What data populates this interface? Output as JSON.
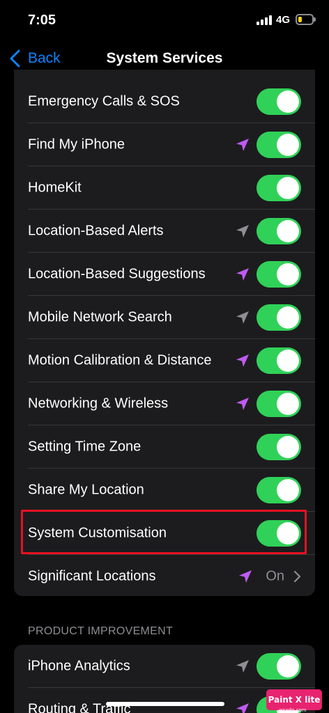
{
  "status_bar": {
    "time": "7:05",
    "network": "4G",
    "battery_level": 0.3,
    "battery_color": "#ffd60a"
  },
  "nav": {
    "back_label": "Back",
    "title": "System Services"
  },
  "colors": {
    "toggle_on": "#30d158",
    "accent": "#0a84ff",
    "recent_location_arrow": "#bf5af2",
    "past_location_arrow": "#8e8e93",
    "highlight_box": "#e81123"
  },
  "services": [
    {
      "label": "Emergency Calls & SOS",
      "location_arrow": "none",
      "enabled": true
    },
    {
      "label": "Find My iPhone",
      "location_arrow": "purple",
      "enabled": true
    },
    {
      "label": "HomeKit",
      "location_arrow": "none",
      "enabled": true
    },
    {
      "label": "Location-Based Alerts",
      "location_arrow": "gray",
      "enabled": true
    },
    {
      "label": "Location-Based Suggestions",
      "location_arrow": "purple",
      "enabled": true
    },
    {
      "label": "Mobile Network Search",
      "location_arrow": "gray",
      "enabled": true
    },
    {
      "label": "Motion Calibration & Distance",
      "location_arrow": "purple",
      "enabled": true
    },
    {
      "label": "Networking & Wireless",
      "location_arrow": "purple",
      "enabled": true
    },
    {
      "label": "Setting Time Zone",
      "location_arrow": "none",
      "enabled": true
    },
    {
      "label": "Share My Location",
      "location_arrow": "none",
      "enabled": true
    },
    {
      "label": "System Customisation",
      "location_arrow": "none",
      "enabled": true,
      "highlighted": true
    }
  ],
  "significant_locations": {
    "label": "Significant Locations",
    "value": "On",
    "location_arrow": "purple"
  },
  "product_improvement": {
    "header": "PRODUCT IMPROVEMENT",
    "items": [
      {
        "label": "iPhone Analytics",
        "location_arrow": "gray",
        "enabled": true
      },
      {
        "label": "Routing & Traffic",
        "location_arrow": "purple",
        "enabled": true
      }
    ]
  },
  "watermark": {
    "text": "Paint X lite",
    "subtext": "wsxdn.com"
  }
}
